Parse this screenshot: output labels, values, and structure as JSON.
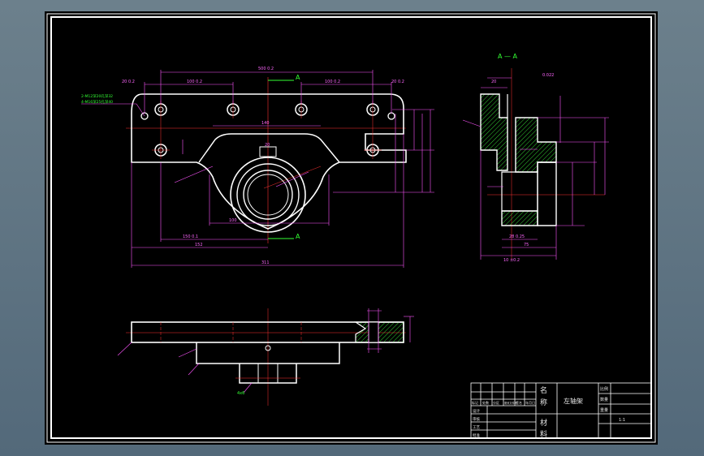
{
  "drawing": {
    "section_label": "A — A",
    "section_mark_top": "A",
    "section_mark_bottom": "A",
    "dims": {
      "top_overall": "500 0.2",
      "top_left": "20 0.2",
      "top_pitch_left": "100 0.2",
      "top_pitch_right": "100 0.2",
      "top_right": "20 0.2",
      "slot_w": "20",
      "width_inner": "140",
      "hub_d": "100",
      "height_bottom": "150 0.1",
      "half_width": "152",
      "overall_width": "311",
      "sec_top": "20",
      "sec_d": "0.022",
      "sec_bottom_a": "28 0.25",
      "sec_bottom_b": "75",
      "sec_bottom_c": "10 ±0.2"
    },
    "notes": {
      "thread_note_1": "2-M12深20孔深32",
      "thread_note_2": "4-M16深25孔深40",
      "bottom_note": "4x6"
    }
  },
  "title_block": {
    "part_name": "左轴架",
    "label_name_1": "名",
    "label_name_2": "称",
    "label_material_1": "材",
    "label_material_2": "料",
    "label_scale": "比例",
    "label_qty": "数量",
    "label_weight": "重量",
    "scale_value": "1:1",
    "col_labels": [
      "标记",
      "处数",
      "分区",
      "更改文件号",
      "签名",
      "年月日"
    ],
    "row_labels": [
      "设计",
      "审核",
      "工艺",
      "批准"
    ]
  }
}
